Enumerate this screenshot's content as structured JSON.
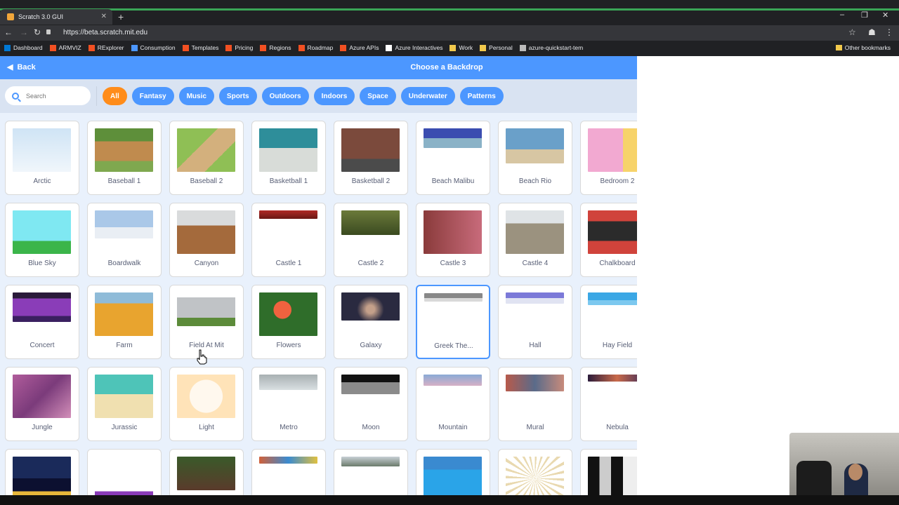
{
  "browser": {
    "tab_title": "Scratch 3.0 GUI",
    "url": "https://beta.scratch.mit.edu",
    "bookmarks": [
      "Dashboard",
      "ARMVIZ",
      "RExplorer",
      "Consumption",
      "Templates",
      "Pricing",
      "Regions",
      "Roadmap",
      "Azure APIs",
      "Azure Interactives",
      "Work",
      "Personal",
      "azure-quickstart-tem"
    ],
    "other_bookmarks": "Other bookmarks"
  },
  "header": {
    "back_label": "Back",
    "title": "Choose a Backdrop"
  },
  "search": {
    "placeholder": "Search"
  },
  "tags": [
    "All",
    "Fantasy",
    "Music",
    "Sports",
    "Outdoors",
    "Indoors",
    "Space",
    "Underwater",
    "Patterns"
  ],
  "backdrops": [
    "Arctic",
    "Baseball 1",
    "Baseball 2",
    "Basketball 1",
    "Basketball 2",
    "Beach Malibu",
    "Beach Rio",
    "Bedroom 2",
    "Blue Sky",
    "Boardwalk",
    "Canyon",
    "Castle 1",
    "Castle 2",
    "Castle 3",
    "Castle 4",
    "Chalkboard",
    "Concert",
    "Farm",
    "Field At Mit",
    "Flowers",
    "Galaxy",
    "Greek The...",
    "Hall",
    "Hay Field",
    "Jungle",
    "Jurassic",
    "Light",
    "Metro",
    "Moon",
    "Mountain",
    "Mural",
    "Nebula",
    "",
    "",
    "",
    "",
    "",
    "",
    "",
    ""
  ]
}
